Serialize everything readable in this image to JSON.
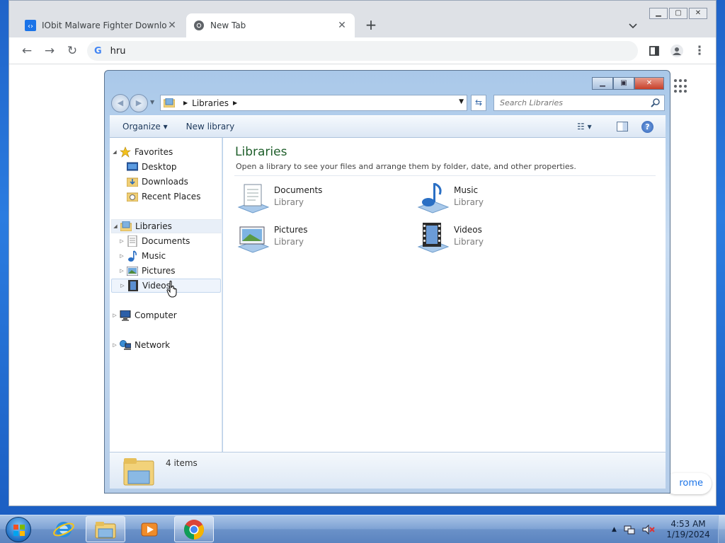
{
  "browser": {
    "tabs": [
      {
        "title": "IObit Malware Fighter Download",
        "icon": "iobit-icon",
        "active": false
      },
      {
        "title": "New Tab",
        "icon": "chrome-icon",
        "active": true
      }
    ],
    "new_tab_label": "+",
    "omnibox_value": "hru",
    "omnibox_provider": "G",
    "customize_label": "rome"
  },
  "explorer": {
    "breadcrumb": {
      "root": "Libraries"
    },
    "search_placeholder": "Search Libraries",
    "commands": {
      "organize": "Organize",
      "new_library": "New library"
    },
    "nav": {
      "favorites": "Favorites",
      "favorites_items": [
        "Desktop",
        "Downloads",
        "Recent Places"
      ],
      "libraries": "Libraries",
      "libraries_items": [
        "Documents",
        "Music",
        "Pictures",
        "Videos"
      ],
      "computer": "Computer",
      "network": "Network"
    },
    "content": {
      "title": "Libraries",
      "description": "Open a library to see your files and arrange them by folder, date, and other properties.",
      "items": [
        {
          "name": "Documents",
          "type": "Library",
          "icon": "documents-library-icon"
        },
        {
          "name": "Music",
          "type": "Library",
          "icon": "music-library-icon"
        },
        {
          "name": "Pictures",
          "type": "Library",
          "icon": "pictures-library-icon"
        },
        {
          "name": "Videos",
          "type": "Library",
          "icon": "videos-library-icon"
        }
      ]
    },
    "details": {
      "count": "4 items"
    }
  },
  "taskbar": {
    "time": "4:53 AM",
    "date": "1/19/2024",
    "pinned": [
      "internet-explorer-icon",
      "file-explorer-icon",
      "media-player-icon",
      "chrome-icon"
    ]
  },
  "colors": {
    "accent": "#1a73e8",
    "library_title": "#1e5e2a",
    "taskbar": "#6a91c8"
  }
}
